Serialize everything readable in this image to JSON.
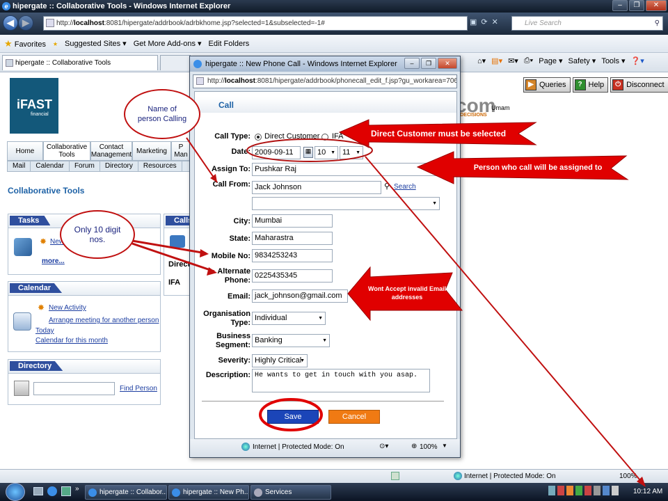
{
  "window": {
    "title": "hipergate :: Collaborative Tools - Windows Internet Explorer",
    "url_prefix": "http://",
    "url_host": "localhost",
    "url_rest": ":8081/hipergate/addrbook/adrbkhome.jsp?selected=1&subselected=-1#",
    "search_placeholder": "Live Search"
  },
  "favorites_bar": {
    "favorites": "Favorites",
    "suggested": "Suggested Sites ▾",
    "addons": "Get More Add-ons ▾",
    "edit_folders": "Edit Folders"
  },
  "tab": {
    "label": "hipergate :: Collaborative Tools"
  },
  "command_bar": {
    "page": "Page ▾",
    "safety": "Safety ▾",
    "tools": "Tools ▾",
    "help": "❓▾"
  },
  "app": {
    "logo_main": "iFAST",
    "logo_sub": "financial",
    "brand_fragment": "com",
    "brand_tag": "T DECISIONS",
    "user": "Umam",
    "queries": "Queries",
    "help": "Help",
    "disconnect": "Disconnect",
    "nav": [
      "Home",
      "Collaborative Tools",
      "Contact Management",
      "Marketing",
      "P Man"
    ],
    "subnav": [
      "Mail",
      "Calendar",
      "Forum",
      "Directory",
      "Resources"
    ],
    "page_title": "Collaborative Tools",
    "tasks": {
      "title": "Tasks",
      "new": "New",
      "more": "more..."
    },
    "calls": {
      "title": "Calls",
      "row1": "Direct",
      "row2": "IFA"
    },
    "calendar": {
      "title": "Calendar",
      "new_activity": "New Activity",
      "arrange": "Arrange meeting for another person",
      "today": "Today",
      "month": "Calendar for this month"
    },
    "directory": {
      "title": "Directory",
      "find": "Find Person"
    }
  },
  "popup": {
    "title": "hipergate :: New Phone Call - Windows Internet Explorer",
    "url_prefix": "http://",
    "url_host": "localhost",
    "url_rest": ":8081/hipergate/addrbook/phonecall_edit_f.jsp?gu_workarea=706e78",
    "heading": "Call",
    "labels": {
      "call_type": "Call Type:",
      "date": "Date:",
      "assign_to": "Assign To:",
      "call_from": "Call From:",
      "city": "City:",
      "state": "State:",
      "mobile": "Mobile No:",
      "alt_phone_1": "Alternate",
      "alt_phone_2": "Phone:",
      "email": "Email:",
      "org_type_1": "Organisation",
      "org_type_2": "Type:",
      "biz_seg_1": "Business",
      "biz_seg_2": "Segment:",
      "severity": "Severity:",
      "description": "Description:"
    },
    "values": {
      "call_type_direct": "Direct Customer",
      "call_type_ifa": "IFA",
      "date": "2009-09-11",
      "hour": "10",
      "minute": "11",
      "assign_to": "Pushkar Raj",
      "call_from": "Jack Johnson",
      "search": "Search",
      "city": "Mumbai",
      "state": "Maharastra",
      "mobile": "9834253243",
      "alt_phone": "0225435345",
      "email": "jack_johnson@gmail.com",
      "org_type": "Individual",
      "biz_seg": "Banking",
      "severity": "Highly Critical",
      "description": "He wants to get in touch with you asap."
    },
    "save": "Save",
    "cancel": "Cancel",
    "status": "Internet | Protected Mode: On",
    "zoom": "100%"
  },
  "statusbar": {
    "zone": "Internet | Protected Mode: On",
    "zoom": "100%"
  },
  "taskbar": {
    "items": [
      "hipergate :: Collabor...",
      "hipergate :: New Ph...",
      "Services"
    ],
    "clock": "10:12 AM"
  },
  "annotations": {
    "cloud_person": "Name of person Calling",
    "cloud_digits": "Only 10 digit nos.",
    "arrow_direct": "Direct Customer must be selected",
    "arrow_assign": "Person who call will be assigned to",
    "arrow_email": "Wont Accept invalid Email addresses"
  },
  "colors": {
    "annotation_red": "#e00000",
    "save_blue": "#1b45b8",
    "cancel_orange": "#f07a13",
    "link_blue": "#1a3ca0"
  }
}
